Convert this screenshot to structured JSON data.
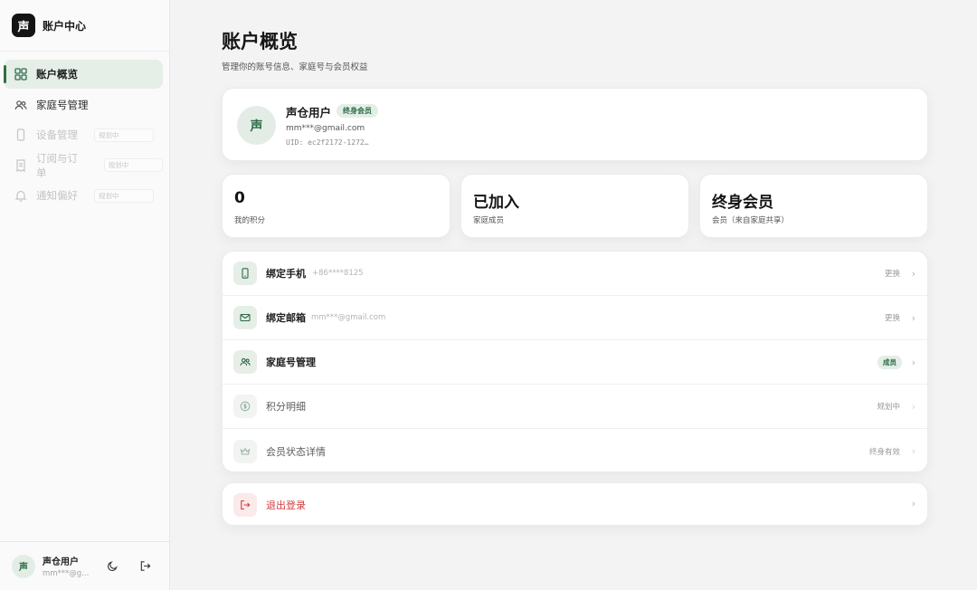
{
  "brand": {
    "logo_char": "声",
    "title": "账户中心"
  },
  "sidebar": {
    "items": [
      {
        "label": "账户概览",
        "icon": "grid-icon",
        "active": true
      },
      {
        "label": "家庭号管理",
        "icon": "users-icon"
      },
      {
        "label": "设备管理",
        "icon": "phone-icon",
        "badge": "规划中",
        "disabled": true
      },
      {
        "label": "订阅与订单",
        "icon": "receipt-icon",
        "badge": "规划中",
        "disabled": true
      },
      {
        "label": "通知偏好",
        "icon": "bell-icon",
        "badge": "规划中",
        "disabled": true
      }
    ],
    "footer": {
      "avatar_char": "声",
      "name": "声仓用户",
      "email": "mm***@g..."
    }
  },
  "page": {
    "title": "账户概览",
    "subtitle": "管理你的账号信息、家庭号与会员权益"
  },
  "profile": {
    "avatar_char": "声",
    "name": "声仓用户",
    "badge": "终身会员",
    "email": "mm***@gmail.com",
    "uid": "UID: ec2f2172-1272…"
  },
  "stats": [
    {
      "value": "0",
      "label": "我的积分"
    },
    {
      "value": "已加入",
      "label": "家庭成员"
    },
    {
      "value": "终身会员",
      "label": "会员（来自家庭共享）"
    }
  ],
  "rows": [
    {
      "label": "绑定手机",
      "sub": "+86****8125",
      "right": "更换",
      "icon": "phone-icon"
    },
    {
      "label": "绑定邮箱",
      "sub": "mm***@gmail.com",
      "right": "更换",
      "icon": "mail-icon"
    },
    {
      "label": "家庭号管理",
      "pill": "成员",
      "icon": "users-icon"
    },
    {
      "label": "积分明细",
      "right": "规划中",
      "icon": "coin-icon"
    },
    {
      "label": "会员状态详情",
      "right": "终身有效",
      "icon": "crown-icon"
    }
  ],
  "logout": {
    "label": "退出登录"
  },
  "chevron": "›",
  "colors": {
    "accent": "#2f6e47",
    "accent_bg": "#e6eee8",
    "danger": "#d33a3a"
  }
}
